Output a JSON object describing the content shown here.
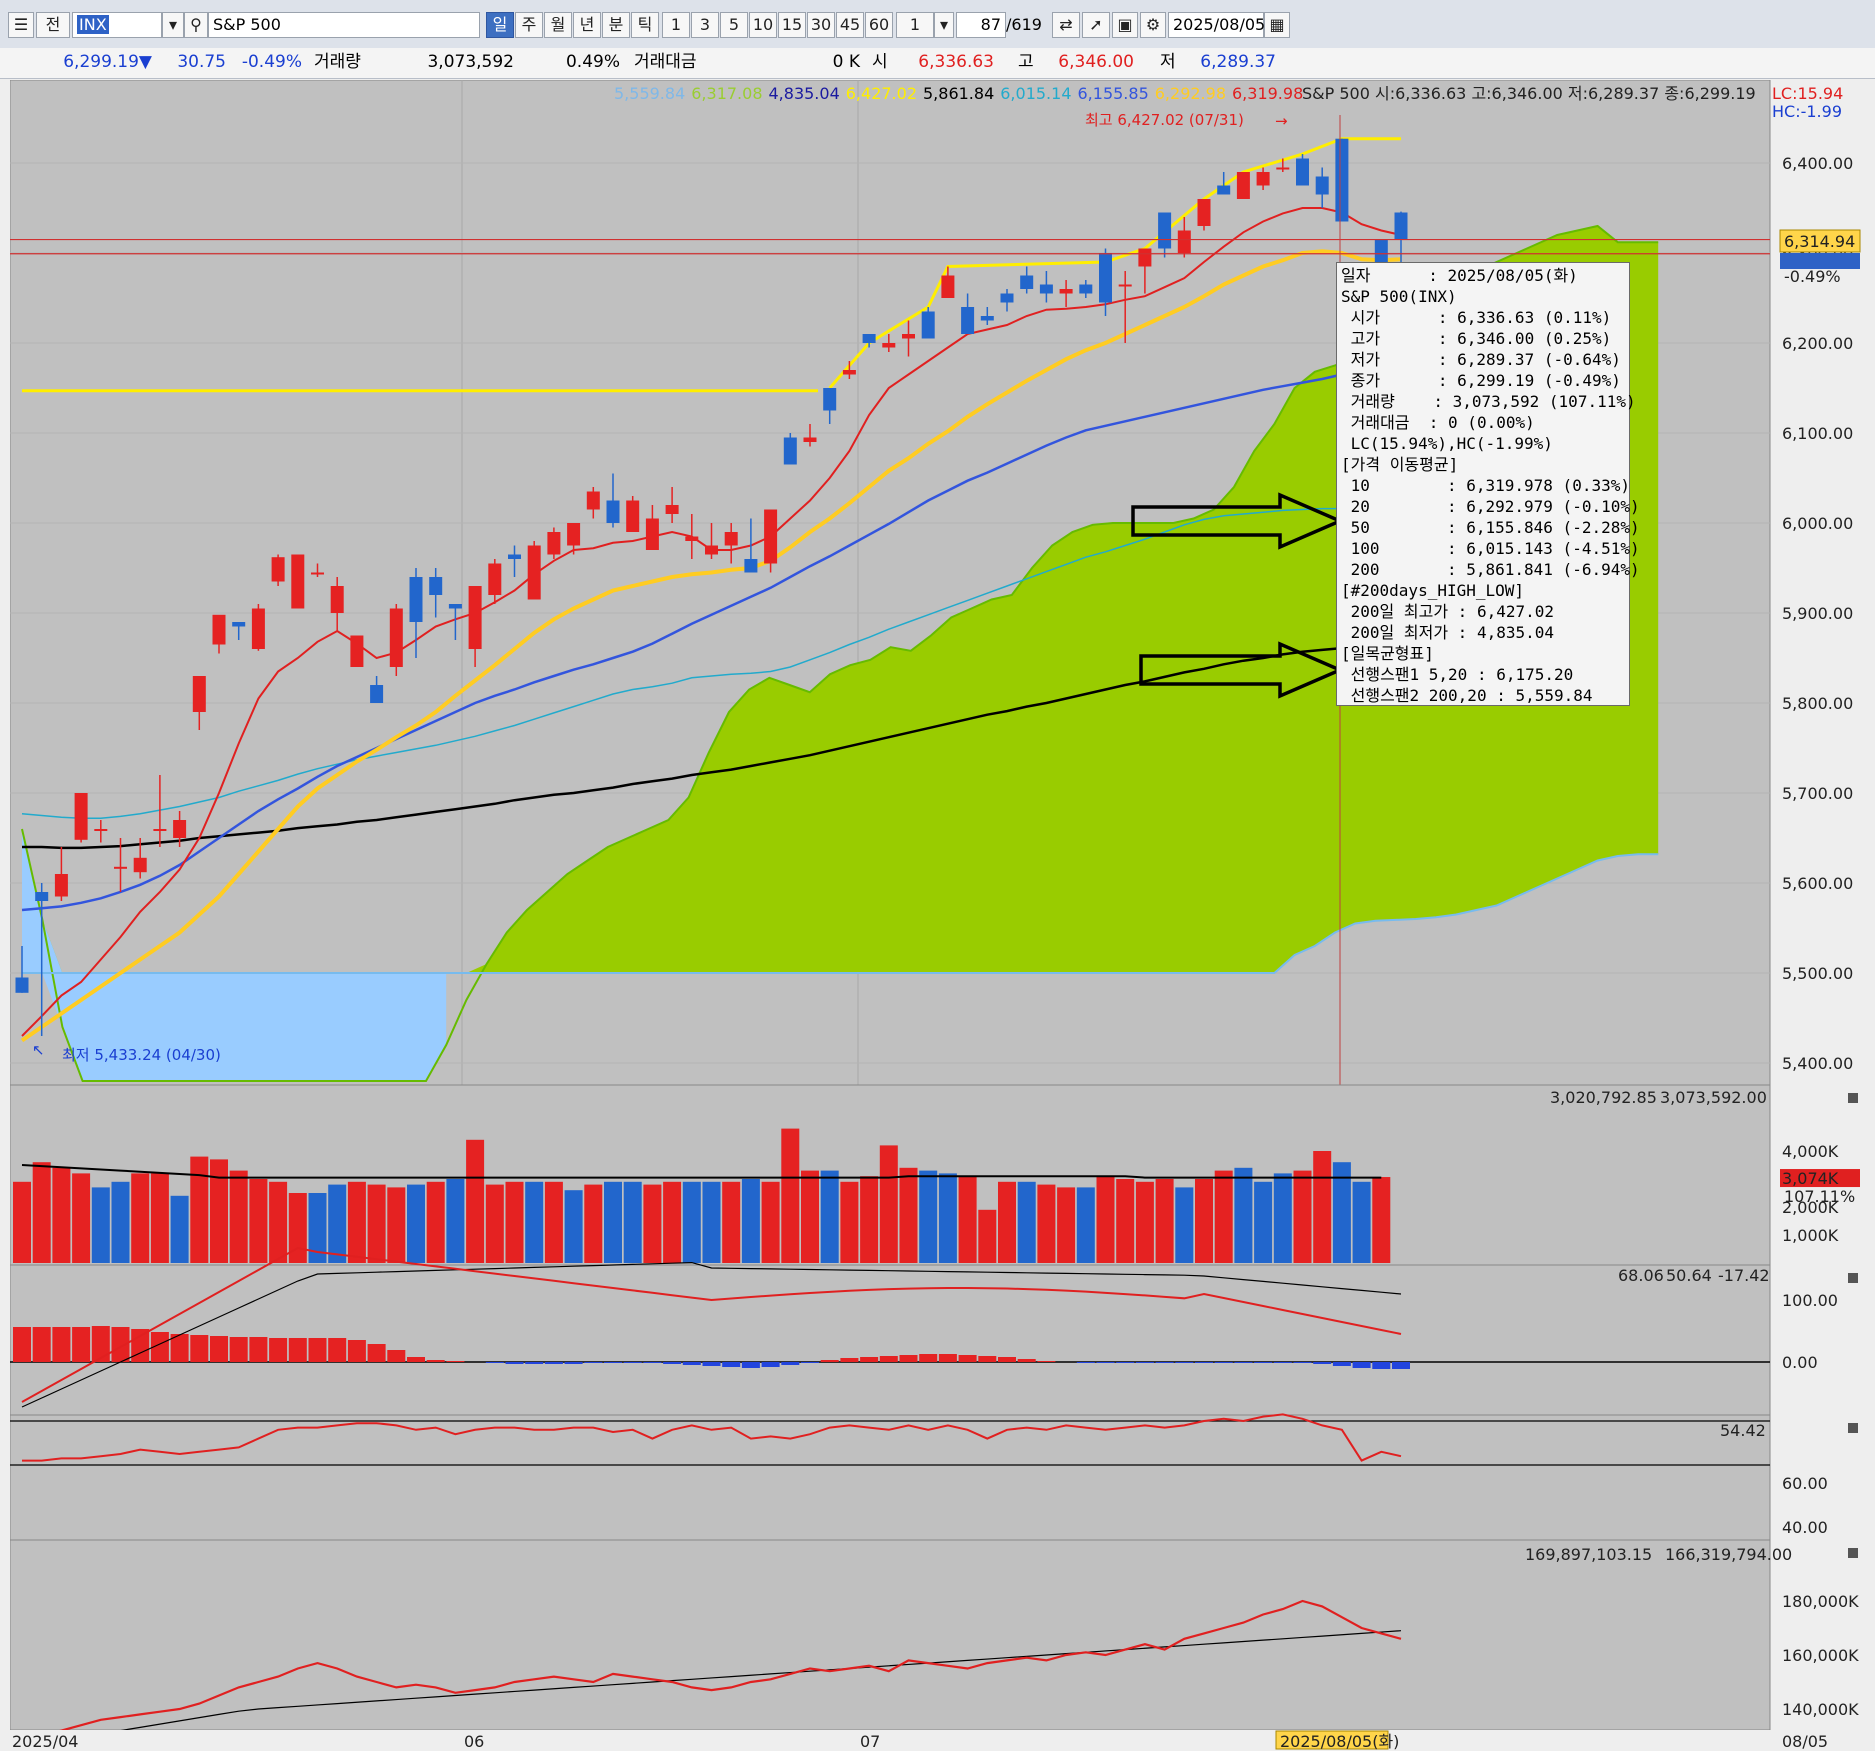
{
  "toolbar": {
    "market_label": "전",
    "code": "INX",
    "name": "S&P 500",
    "periods": [
      "일",
      "주",
      "월",
      "년",
      "분",
      "틱"
    ],
    "selected_period": "일",
    "intervals": [
      "1",
      "3",
      "5",
      "10",
      "15",
      "30",
      "45",
      "60"
    ],
    "multiplier": "1",
    "count": "87",
    "total": "/619",
    "date": "2025/08/05"
  },
  "quote": {
    "price": "6,299.19▼",
    "change": "30.75",
    "change_pct": "-0.49%",
    "volume_label": "거래량",
    "volume": "3,073,592",
    "volume_pct": "0.49%",
    "turnover_label": "거래대금",
    "turnover": "0 K",
    "open_label": "시",
    "open": "6,336.63",
    "high_label": "고",
    "high": "6,346.00",
    "low_label": "저",
    "low": "6,289.37"
  },
  "legend": {
    "ma_values": [
      {
        "text": "5,559.84",
        "color": "#7fb8e8"
      },
      {
        "text": "6,317.08",
        "color": "#9acd32"
      },
      {
        "text": "4,835.04",
        "color": "#1a1aa0"
      },
      {
        "text": "6,427.02",
        "color": "#ffee00"
      },
      {
        "text": "5,861.84",
        "color": "#000000"
      },
      {
        "text": "6,015.14",
        "color": "#22aacc"
      },
      {
        "text": "6,155.85",
        "color": "#3355dd"
      },
      {
        "text": "6,292.98",
        "color": "#ffcc22"
      },
      {
        "text": "6,319.98",
        "color": "#e02020"
      }
    ],
    "ohlc_text": "S&P 500 시:6,336.63 고:6,346.00 저:6,289.37 종:6,299.19",
    "lc": "LC:15.94",
    "hc": "HC:-1.99",
    "high_marker": "최고 6,427.02 (07/31)",
    "low_marker": "최저 5,433.24 (04/30)",
    "current_price_box": "6,314.94",
    "current_change": "-0.49%"
  },
  "tooltip": {
    "rows": [
      "일자      : 2025/08/05(화)",
      "S&P 500(INX)",
      " 시가      : 6,336.63 (0.11%)",
      " 고가      : 6,346.00 (0.25%)",
      " 저가      : 6,289.37 (-0.64%)",
      " 종가      : 6,299.19 (-0.49%)",
      " 거래량    : 3,073,592 (107.11%)",
      " 거래대금  : 0 (0.00%)",
      " LC(15.94%),HC(-1.99%)",
      "[가격 이동평균]",
      " 10        : 6,319.978 (0.33%)",
      " 20        : 6,292.979 (-0.10%)",
      " 50        : 6,155.846 (-2.28%)",
      " 100       : 6,015.143 (-4.51%)",
      " 200       : 5,861.841 (-6.94%)",
      "[#200days_HIGH_LOW]",
      " 200일 최고가 : 6,427.02",
      " 200일 최저가 : 4,835.04",
      "[일목균형표]",
      " 선행스팬1 5,20 : 6,175.20",
      " 선행스팬2 200,20 : 5,559.84"
    ]
  },
  "panels": {
    "volume_header": "3,020,792.85",
    "volume_header2": "3,073,592.00",
    "volume_badge": "3,074K",
    "volume_pct": "107.11%",
    "macd_header": "68.06",
    "macd_header2": "50.64",
    "macd_header3": "-17.42",
    "rsi_header": "54.42",
    "obv_header": "169,897,103.15",
    "obv_header2": "166,319,794.00"
  },
  "chart_data": {
    "type": "candlestick",
    "title": "S&P 500",
    "price_axis": {
      "min": 5400,
      "max": 6400,
      "ticks": [
        "6,400.00",
        "6,300.00",
        "6,200.00",
        "6,100.00",
        "6,000.00",
        "5,900.00",
        "5,800.00",
        "5,700.00",
        "5,600.00",
        "5,500.00",
        "5,400.00"
      ]
    },
    "x_labels": [
      "2025/04",
      "06",
      "07",
      "2025/08/05(화)",
      "08/05"
    ],
    "reference_lines": [
      6314.94,
      6299.19
    ],
    "high_line": 6427.02,
    "prior_high_line": 6147,
    "candles": [
      [
        5495,
        5530,
        5478,
        5478
      ],
      [
        5590,
        5600,
        5430,
        5580
      ],
      [
        5585,
        5640,
        5580,
        5610
      ],
      [
        5648,
        5700,
        5645,
        5700
      ],
      [
        5660,
        5670,
        5645,
        5660
      ],
      [
        5618,
        5650,
        5590,
        5618
      ],
      [
        5612,
        5650,
        5605,
        5628
      ],
      [
        5660,
        5720,
        5640,
        5660
      ],
      [
        5650,
        5680,
        5640,
        5670
      ],
      [
        5790,
        5800,
        5770,
        5830
      ],
      [
        5865,
        5890,
        5855,
        5898
      ],
      [
        5890,
        5890,
        5870,
        5885
      ],
      [
        5860,
        5910,
        5858,
        5905
      ],
      [
        5935,
        5965,
        5930,
        5962
      ],
      [
        5905,
        5965,
        5905,
        5965
      ],
      [
        5945,
        5955,
        5940,
        5945
      ],
      [
        5900,
        5940,
        5880,
        5930
      ],
      [
        5840,
        5875,
        5840,
        5875
      ],
      [
        5820,
        5830,
        5800,
        5800
      ],
      [
        5840,
        5910,
        5830,
        5905
      ],
      [
        5940,
        5950,
        5850,
        5890
      ],
      [
        5940,
        5950,
        5895,
        5920
      ],
      [
        5910,
        5910,
        5870,
        5905
      ],
      [
        5860,
        5915,
        5840,
        5930
      ],
      [
        5920,
        5960,
        5910,
        5955
      ],
      [
        5965,
        5975,
        5940,
        5960
      ],
      [
        5915,
        5980,
        5915,
        5975
      ],
      [
        5965,
        5995,
        5960,
        5990
      ],
      [
        5975,
        6000,
        5965,
        6000
      ],
      [
        6015,
        6040,
        6005,
        6035
      ],
      [
        6025,
        6055,
        5995,
        6000
      ],
      [
        5990,
        6030,
        5990,
        6025
      ],
      [
        5970,
        6020,
        5970,
        6005
      ],
      [
        6010,
        6040,
        6000,
        6020
      ],
      [
        5980,
        6010,
        5960,
        5985
      ],
      [
        5965,
        6000,
        5960,
        5975
      ],
      [
        5975,
        6000,
        5955,
        5990
      ],
      [
        5960,
        6005,
        5950,
        5945
      ],
      [
        5955,
        6015,
        5945,
        6015
      ],
      [
        6095,
        6100,
        6065,
        6065
      ],
      [
        6090,
        6110,
        6085,
        6095
      ],
      [
        6150,
        6150,
        6110,
        6125
      ],
      [
        6165,
        6180,
        6160,
        6170
      ],
      [
        6210,
        6200,
        6195,
        6200
      ],
      [
        6195,
        6210,
        6190,
        6200
      ],
      [
        6205,
        6225,
        6185,
        6210
      ],
      [
        6235,
        6240,
        6205,
        6205
      ],
      [
        6250,
        6285,
        6250,
        6275
      ],
      [
        6240,
        6255,
        6210,
        6210
      ],
      [
        6230,
        6240,
        6220,
        6225
      ],
      [
        6255,
        6260,
        6235,
        6245
      ],
      [
        6275,
        6285,
        6255,
        6260
      ],
      [
        6265,
        6280,
        6245,
        6255
      ],
      [
        6255,
        6270,
        6240,
        6260
      ],
      [
        6265,
        6270,
        6250,
        6255
      ],
      [
        6300,
        6305,
        6230,
        6245
      ],
      [
        6265,
        6280,
        6200,
        6265
      ],
      [
        6285,
        6305,
        6255,
        6305
      ],
      [
        6345,
        6340,
        6295,
        6305
      ],
      [
        6300,
        6340,
        6295,
        6325
      ],
      [
        6330,
        6360,
        6325,
        6360
      ],
      [
        6375,
        6390,
        6365,
        6365
      ],
      [
        6360,
        6390,
        6370,
        6390
      ],
      [
        6375,
        6395,
        6370,
        6390
      ],
      [
        6395,
        6405,
        6390,
        6395
      ],
      [
        6405,
        6410,
        6375,
        6375
      ],
      [
        6385,
        6395,
        6350,
        6365
      ],
      [
        6427,
        6427,
        6335,
        6335
      ],
      [
        6280,
        6285,
        6215,
        6235
      ],
      [
        6315,
        6315,
        6245,
        6255
      ],
      [
        6345,
        6346,
        6289,
        6315
      ]
    ],
    "ma10": [
      5430,
      5452,
      5475,
      5490,
      5515,
      5540,
      5568,
      5590,
      5615,
      5650,
      5700,
      5755,
      5805,
      5835,
      5850,
      5868,
      5880,
      5866,
      5850,
      5856,
      5870,
      5885,
      5893,
      5900,
      5912,
      5925,
      5943,
      5958,
      5970,
      5972,
      5978,
      5980,
      5985,
      5990,
      5985,
      5970,
      5970,
      5975,
      5985,
      6005,
      6025,
      6050,
      6080,
      6120,
      6150,
      6165,
      6180,
      6195,
      6210,
      6215,
      6220,
      6230,
      6237,
      6238,
      6240,
      6243,
      6248,
      6252,
      6262,
      6272,
      6290,
      6307,
      6323,
      6335,
      6344,
      6350,
      6350,
      6345,
      6332,
      6325,
      6320
    ],
    "ma20": [
      5425,
      5440,
      5455,
      5470,
      5485,
      5500,
      5515,
      5530,
      5545,
      5565,
      5585,
      5610,
      5635,
      5660,
      5685,
      5705,
      5720,
      5735,
      5748,
      5762,
      5775,
      5790,
      5808,
      5825,
      5842,
      5860,
      5878,
      5893,
      5905,
      5915,
      5925,
      5930,
      5935,
      5940,
      5943,
      5945,
      5948,
      5950,
      5958,
      5973,
      5990,
      6005,
      6022,
      6040,
      6058,
      6072,
      6088,
      6102,
      6118,
      6132,
      6145,
      6158,
      6170,
      6182,
      6192,
      6200,
      6210,
      6220,
      6230,
      6240,
      6252,
      6265,
      6275,
      6285,
      6292,
      6300,
      6302,
      6300,
      6293,
      6292,
      6293
    ],
    "ma50": [
      5570,
      5572,
      5574,
      5578,
      5583,
      5590,
      5598,
      5608,
      5620,
      5635,
      5650,
      5665,
      5680,
      5693,
      5705,
      5718,
      5730,
      5740,
      5750,
      5760,
      5770,
      5780,
      5790,
      5800,
      5808,
      5815,
      5823,
      5830,
      5837,
      5843,
      5850,
      5857,
      5866,
      5877,
      5888,
      5898,
      5908,
      5918,
      5928,
      5940,
      5952,
      5963,
      5975,
      5987,
      5999,
      6012,
      6025,
      6036,
      6047,
      6056,
      6066,
      6076,
      6086,
      6095,
      6103,
      6108,
      6113,
      6118,
      6123,
      6128,
      6133,
      6138,
      6143,
      6148,
      6152,
      6156,
      6160,
      6165,
      6170,
      6173,
      6176
    ],
    "ma100": [
      5677,
      5675,
      5673,
      5672,
      5672,
      5674,
      5677,
      5681,
      5685,
      5690,
      5695,
      5702,
      5708,
      5714,
      5721,
      5727,
      5732,
      5737,
      5741,
      5745,
      5749,
      5753,
      5758,
      5763,
      5769,
      5775,
      5782,
      5789,
      5796,
      5803,
      5810,
      5815,
      5818,
      5822,
      5828,
      5830,
      5832,
      5833,
      5835,
      5840,
      5848,
      5856,
      5865,
      5873,
      5882,
      5890,
      5898,
      5906,
      5914,
      5922,
      5930,
      5938,
      5946,
      5954,
      5962,
      5968,
      5975,
      5982,
      5990,
      5998,
      6004,
      6008,
      6010,
      6012,
      6014,
      6015,
      6016,
      6016,
      6016,
      6015,
      6015
    ],
    "ma200": [
      5640,
      5640,
      5639,
      5639,
      5640,
      5641,
      5643,
      5645,
      5647,
      5650,
      5652,
      5654,
      5656,
      5658,
      5661,
      5663,
      5665,
      5668,
      5670,
      5673,
      5676,
      5679,
      5682,
      5685,
      5688,
      5692,
      5695,
      5698,
      5700,
      5703,
      5706,
      5710,
      5713,
      5716,
      5720,
      5723,
      5726,
      5730,
      5734,
      5738,
      5742,
      5747,
      5752,
      5757,
      5762,
      5767,
      5772,
      5777,
      5782,
      5787,
      5791,
      5796,
      5800,
      5805,
      5810,
      5815,
      5820,
      5824,
      5829,
      5834,
      5838,
      5843,
      5847,
      5850,
      5854,
      5857,
      5859,
      5861,
      5862,
      5862,
      5862
    ],
    "cloud_span1": [
      5660,
      5560,
      5440,
      5380,
      5380,
      5380,
      5380,
      5380,
      5380,
      5380,
      5380,
      5380,
      5380,
      5380,
      5380,
      5380,
      5380,
      5380,
      5380,
      5380,
      5380,
      5420,
      5470,
      5510,
      5545,
      5570,
      5590,
      5610,
      5625,
      5640,
      5650,
      5660,
      5670,
      5695,
      5745,
      5790,
      5815,
      5828,
      5820,
      5812,
      5832,
      5842,
      5848,
      5862,
      5858,
      5875,
      5895,
      5905,
      5915,
      5920,
      5950,
      5975,
      5990,
      5998,
      6000,
      6000,
      6000,
      6000,
      6005,
      6015,
      6040,
      6080,
      6110,
      6150,
      6168,
      6175,
      6185,
      6195,
      6215,
      6238,
      6262,
      6270,
      6280,
      6290,
      6300,
      6310,
      6320,
      6325,
      6330,
      6312,
      6312,
      6312
    ],
    "cloud_span2": [
      5500,
      5500,
      5500,
      5500,
      5500,
      5500,
      5500,
      5500,
      5500,
      5500,
      5500,
      5500,
      5500,
      5500,
      5500,
      5500,
      5500,
      5500,
      5500,
      5500,
      5500,
      5500,
      5500,
      5500,
      5500,
      5500,
      5500,
      5500,
      5500,
      5500,
      5500,
      5500,
      5500,
      5500,
      5500,
      5500,
      5500,
      5500,
      5500,
      5500,
      5500,
      5500,
      5500,
      5500,
      5500,
      5500,
      5500,
      5500,
      5500,
      5500,
      5500,
      5500,
      5500,
      5500,
      5500,
      5500,
      5500,
      5500,
      5500,
      5500,
      5500,
      5500,
      5500,
      5520,
      5530,
      5545,
      5555,
      5558,
      5559,
      5560,
      5562,
      5565,
      5570,
      5575,
      5585,
      5595,
      5605,
      5615,
      5625,
      5630,
      5632,
      5632
    ],
    "volume_axis": {
      "ticks": [
        "4,000K",
        "2,000K",
        "1,000K"
      ]
    },
    "volume_color": [
      "r",
      "r",
      "r",
      "r",
      "b",
      "b",
      "r",
      "r",
      "b",
      "r",
      "r",
      "r",
      "r",
      "r",
      "r",
      "b",
      "b",
      "r",
      "r",
      "r",
      "b",
      "r",
      "b",
      "r",
      "r",
      "r",
      "b",
      "r",
      "b",
      "r",
      "b",
      "b",
      "r",
      "r",
      "b",
      "b",
      "r",
      "b",
      "r",
      "r",
      "r",
      "b",
      "r",
      "r",
      "r",
      "r",
      "b",
      "b",
      "r",
      "r",
      "r",
      "b",
      "r",
      "r",
      "b",
      "r",
      "r",
      "r",
      "r",
      "b",
      "r",
      "r",
      "b",
      "b",
      "b",
      "r",
      "r",
      "b",
      "b",
      "r",
      "b"
    ],
    "volume": [
      2.9,
      3.6,
      3.4,
      3.2,
      2.7,
      2.9,
      3.2,
      3.2,
      2.4,
      3.8,
      3.7,
      3.3,
      3.0,
      2.9,
      2.5,
      2.5,
      2.8,
      2.9,
      2.8,
      2.7,
      2.8,
      2.9,
      3.0,
      4.4,
      2.8,
      2.9,
      2.9,
      2.9,
      2.6,
      2.8,
      2.9,
      2.9,
      2.8,
      2.9,
      2.9,
      2.9,
      2.9,
      3.0,
      2.9,
      4.8,
      3.3,
      3.3,
      2.9,
      3.1,
      4.2,
      3.4,
      3.3,
      3.2,
      3.1,
      1.9,
      2.9,
      2.9,
      2.8,
      2.7,
      2.7,
      3.1,
      3.0,
      2.9,
      3.0,
      2.7,
      3.0,
      3.3,
      3.4,
      2.9,
      3.2,
      3.3,
      4.0,
      3.6,
      2.9,
      3.07
    ],
    "macd_axis": {
      "ticks": [
        "100.00",
        "0.00"
      ]
    },
    "rsi_axis": {
      "ticks": [
        "60.00",
        "40.00"
      ]
    },
    "obv_axis": {
      "ticks": [
        "180,000K",
        "160,000K",
        "140,000K"
      ]
    }
  }
}
